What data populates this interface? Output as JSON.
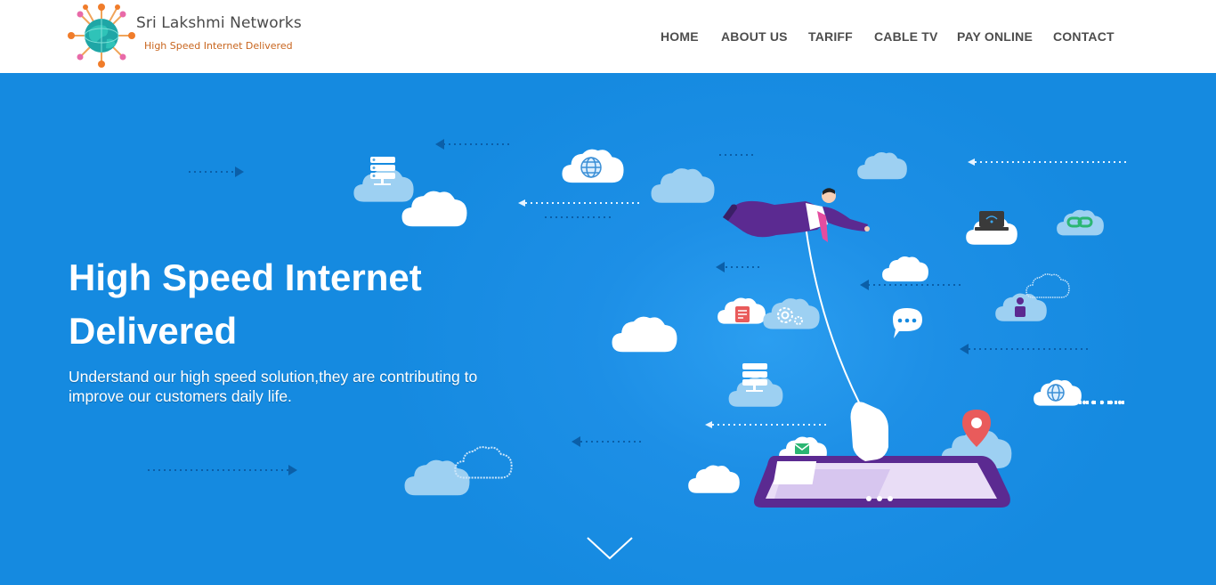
{
  "brand": {
    "name": "Sri Lakshmi Networks",
    "tagline": "High Speed Internet Delivered"
  },
  "nav": {
    "items": [
      "HOME",
      "ABOUT US",
      "TARIFF",
      "CABLE TV",
      "PAY ONLINE",
      "CONTACT"
    ]
  },
  "hero": {
    "title_line1": "High Speed Internet",
    "title_line2": "Delivered",
    "subtitle": "Understand our high speed solution,they are contributing to improve our customers daily life."
  },
  "colors": {
    "hero_blue": "#158ae0",
    "nav_text": "#4d4d4d",
    "tagline": "#c8651e",
    "accent_purple": "#5b2a91"
  },
  "icons": [
    "globe-logo-icon",
    "server-icon",
    "globe-icon",
    "laptop-wifi-icon",
    "link-icon",
    "user-icon",
    "document-icon",
    "gear-icon",
    "chat-icon",
    "map-pin-icon",
    "email-icon",
    "chevron-down-icon"
  ]
}
